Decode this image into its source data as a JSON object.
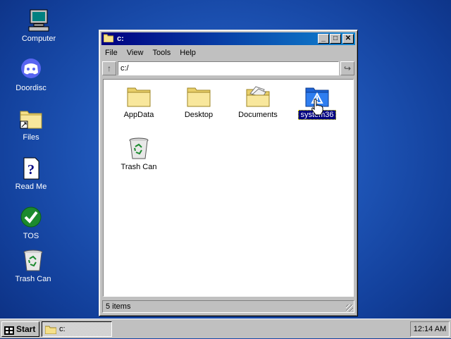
{
  "desktop": {
    "icons": [
      {
        "label": "Computer",
        "icon": "computer-icon"
      },
      {
        "label": "Doordisc",
        "icon": "doordisc-icon"
      },
      {
        "label": "Files",
        "icon": "folder-shortcut-icon"
      },
      {
        "label": "Read Me",
        "icon": "help-document-icon"
      },
      {
        "label": "TOS",
        "icon": "checkmark-icon"
      },
      {
        "label": "Trash Can",
        "icon": "trash-can-icon"
      }
    ]
  },
  "window": {
    "title": "c:",
    "controls": {
      "minimize": "_",
      "maximize": "□",
      "close": "✕"
    },
    "menu": [
      "File",
      "View",
      "Tools",
      "Help"
    ],
    "address": {
      "value": "c:/",
      "up_label": "↑",
      "go_label": "↪"
    },
    "files": [
      {
        "label": "AppData",
        "icon": "folder-icon",
        "selected": false
      },
      {
        "label": "Desktop",
        "icon": "folder-icon",
        "selected": false
      },
      {
        "label": "Documents",
        "icon": "documents-folder-icon",
        "selected": false
      },
      {
        "label": "system36",
        "icon": "system-folder-icon",
        "selected": true
      },
      {
        "label": "Trash Can",
        "icon": "trash-can-icon",
        "selected": false
      }
    ],
    "status": "5 items"
  },
  "taskbar": {
    "start_label": "Start",
    "tasks": [
      {
        "label": "c:"
      }
    ],
    "clock": "12:14 AM"
  },
  "colors": {
    "desktop": "#1f56b8",
    "titlebar_start": "#000080",
    "titlebar_end": "#1084d0",
    "selection": "#000080",
    "folder_yellow": "#f5e08a"
  }
}
